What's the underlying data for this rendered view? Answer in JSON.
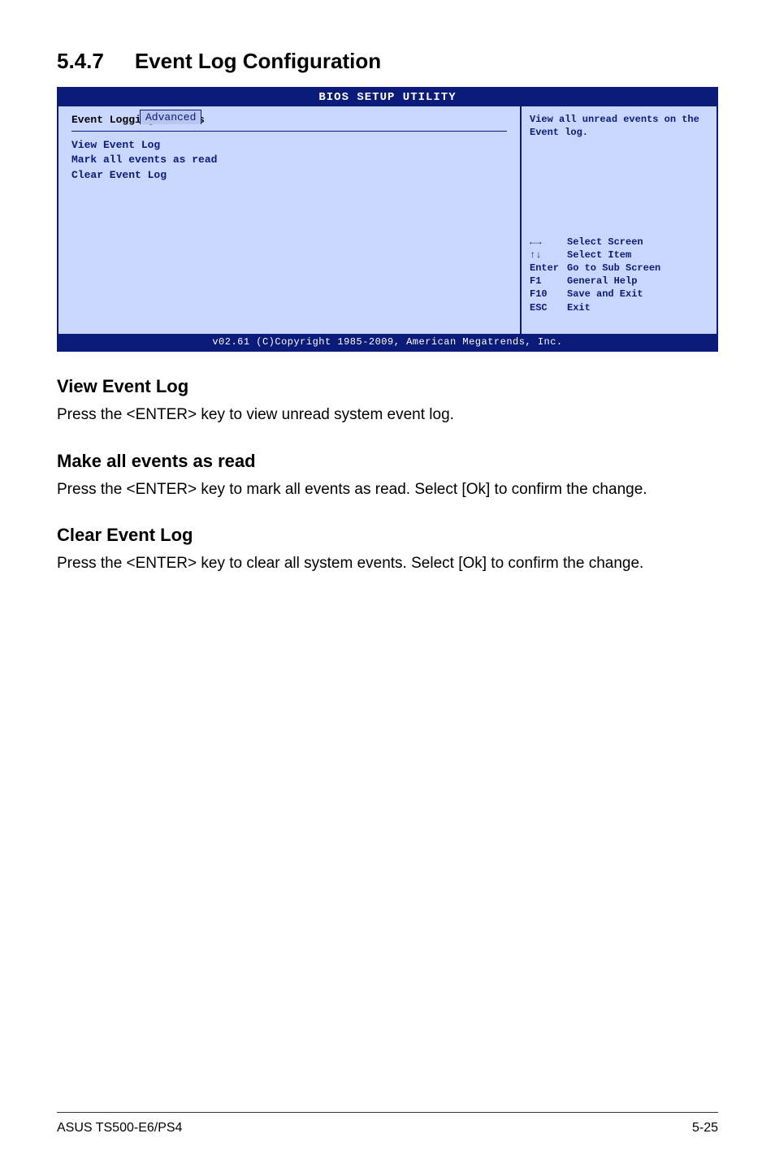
{
  "heading": {
    "number": "5.4.7",
    "title": "Event Log Configuration"
  },
  "bios": {
    "utility_title": "BIOS SETUP UTILITY",
    "tab": "Advanced",
    "panel_title": "Event Logging details",
    "menu": {
      "view": "View Event Log",
      "mark": "Mark all events as read",
      "clear": "Clear Event Log"
    },
    "help": "View all unread events on the Event log.",
    "keys": {
      "lr": {
        "key": "←→",
        "label": "Select Screen"
      },
      "ud": {
        "key": "↑↓",
        "label": "Select Item"
      },
      "enter": {
        "key": "Enter",
        "label": "Go to Sub Screen"
      },
      "f1": {
        "key": "F1",
        "label": "General Help"
      },
      "f10": {
        "key": "F10",
        "label": "Save and Exit"
      },
      "esc": {
        "key": "ESC",
        "label": "Exit"
      }
    },
    "footer": "v02.61 (C)Copyright 1985-2009, American Megatrends, Inc."
  },
  "sections": {
    "view": {
      "title": "View Event Log",
      "body": "Press the <ENTER> key to view unread system event log."
    },
    "make": {
      "title": "Make all events as read",
      "body": "Press the <ENTER> key to mark all events as read. Select [Ok] to confirm the change."
    },
    "clear": {
      "title": "Clear Event Log",
      "body": "Press the <ENTER> key to clear all system events. Select [Ok] to confirm the change."
    }
  },
  "footer": {
    "product": "ASUS TS500-E6/PS4",
    "page": "5-25"
  }
}
